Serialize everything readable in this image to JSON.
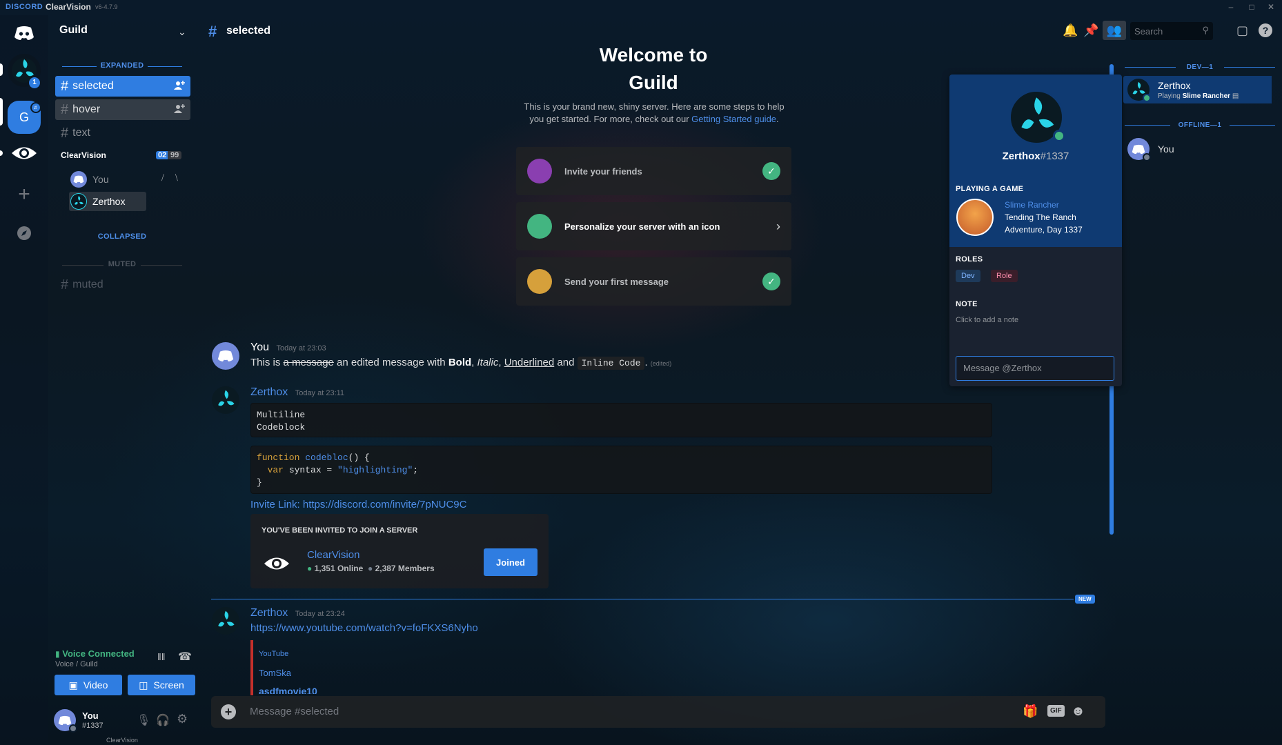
{
  "titlebar": {
    "brand": "DISCORD",
    "app": "ClearVision",
    "version": "v6-4.7.9"
  },
  "guilds": {
    "g_letter": "G",
    "unread_badge": "1"
  },
  "guild": {
    "name": "Guild"
  },
  "categories": {
    "expanded": "EXPANDED",
    "collapsed": "COLLAPSED",
    "muted": "MUTED"
  },
  "channels": {
    "selected": "selected",
    "hover": "hover",
    "text": "text",
    "muted": "muted"
  },
  "voice_channel": {
    "name": "ClearVision",
    "count": "02",
    "limit": "99",
    "users": [
      {
        "name": "You"
      },
      {
        "name": "Zerthox"
      }
    ]
  },
  "voice_panel": {
    "status": "Voice Connected",
    "location": "Voice / Guild",
    "video": "Video",
    "screen": "Screen"
  },
  "user_panel": {
    "name": "You",
    "tag": "#1337",
    "guild_label": "ClearVision"
  },
  "header": {
    "hash": "#",
    "channel": "selected",
    "search_placeholder": "Search"
  },
  "welcome": {
    "title_line1": "Welcome to",
    "title_line2": "Guild",
    "desc": "This is your brand new, shiny server. Here are some steps to help you get started. For more, check out our ",
    "link": "Getting Started guide",
    "desc_end": ".",
    "cards": [
      {
        "label": "Invite your friends"
      },
      {
        "label": "Personalize your server with an icon"
      },
      {
        "label": "Send your first message"
      }
    ]
  },
  "messages": {
    "m1": {
      "author": "You",
      "time": "Today at 23:03",
      "t1": "This is ",
      "strike": "a message",
      "t2": " an edited message with ",
      "bold": "Bold",
      "t3": ", ",
      "italic": "Italic",
      "t4": ", ",
      "underline": "Underlined",
      "t5": " and ",
      "code": "Inline Code",
      "t6": ".",
      "edited": "(edited)"
    },
    "m2": {
      "author": "Zerthox",
      "time": "Today at 23:11",
      "code1_l1": "Multiline",
      "code1_l2": "Codeblock",
      "code2_kw1": "function",
      "code2_fn": "codebloc",
      "code2_rest1": "() {",
      "code2_kw2": "var",
      "code2_var": " syntax = ",
      "code2_str": "\"highlighting\"",
      "code2_end": ";",
      "code2_close": "}",
      "invite_label": "Invite Link: ",
      "invite_url": "https://discord.com/invite/7pNUC9C",
      "invite_header": "YOU'VE BEEN INVITED TO JOIN A SERVER",
      "invite_server": "ClearVision",
      "invite_online": "1,351 Online",
      "invite_members": "2,387 Members",
      "invite_button": "Joined"
    },
    "new_label": "NEW",
    "m3": {
      "author": "Zerthox",
      "time": "Today at 23:24",
      "url": "https://www.youtube.com/watch?v=foFKXS6Nyho",
      "embed_provider": "YouTube",
      "embed_author": "TomSka",
      "embed_title": "asdfmovie10"
    }
  },
  "composer": {
    "placeholder": "Message #selected",
    "gif": "GIF"
  },
  "popout": {
    "username": "Zerthox",
    "discrim": "#1337",
    "activity_header": "PLAYING A GAME",
    "game": "Slime Rancher",
    "details1": "Tending The Ranch",
    "details2": "Adventure, Day 1337",
    "roles_header": "ROLES",
    "roles": [
      "Dev",
      "Role"
    ],
    "note_header": "NOTE",
    "note_placeholder": "Click to add a note",
    "message_placeholder": "Message @Zerthox"
  },
  "members": {
    "dev_header": "DEV—1",
    "offline_header": "OFFLINE—1",
    "dev": [
      {
        "name": "Zerthox",
        "activity_prefix": "Playing ",
        "activity": "Slime Rancher"
      }
    ],
    "offline": [
      {
        "name": "You"
      }
    ]
  },
  "colors": {
    "accent": "#2f7de1",
    "online": "#43b581",
    "role_dev": "#3a6ea5",
    "role_role": "#a54a6b"
  }
}
